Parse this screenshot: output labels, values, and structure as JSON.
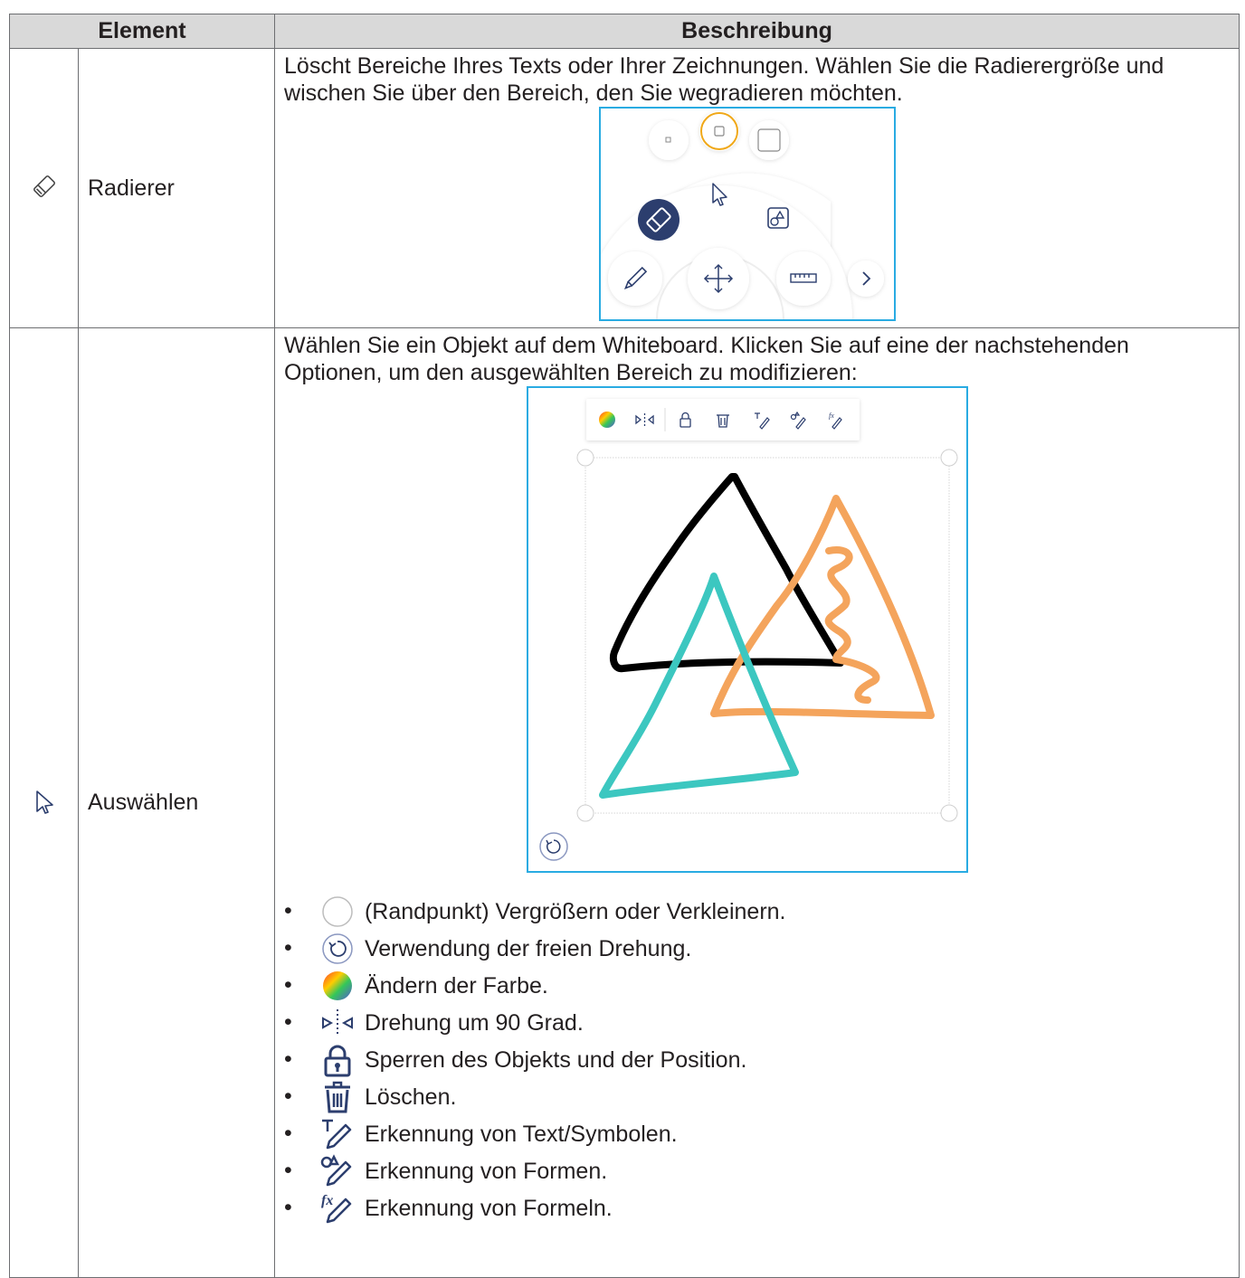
{
  "table": {
    "headers": {
      "element": "Element",
      "description": "Beschreibung"
    },
    "rows": [
      {
        "name": "Radierer",
        "icon": "eraser-icon",
        "description": "Löscht Bereiche Ihres Texts oder Ihrer Zeichnungen. Wählen Sie die Radierergröße und wischen Sie über den Bereich, den Sie wegradieren möchten."
      },
      {
        "name": "Auswählen",
        "icon": "select-arrow-icon",
        "description": "Wählen Sie ein Objekt auf dem Whiteboard. Klicken Sie auf eine der nachstehenden Optionen, um den ausgewählten Bereich zu modifizieren:",
        "bullets": [
          {
            "icon": "handle-point-icon",
            "text": "(Randpunkt) Vergrößern oder Verkleinern."
          },
          {
            "icon": "rotate-icon",
            "text": "Verwendung der freien Drehung."
          },
          {
            "icon": "color-wheel-icon",
            "text": "Ändern der Farbe."
          },
          {
            "icon": "flip-icon",
            "text": "Drehung um 90 Grad."
          },
          {
            "icon": "lock-icon",
            "text": "Sperren des Objekts und der Position."
          },
          {
            "icon": "trash-icon",
            "text": "Löschen."
          },
          {
            "icon": "text-recognition-icon",
            "text": "Erkennung von Text/Symbolen."
          },
          {
            "icon": "shape-recognition-icon",
            "text": "Erkennung von Formen."
          },
          {
            "icon": "formula-recognition-icon",
            "text": "Erkennung von Formeln."
          }
        ]
      }
    ]
  },
  "colors": {
    "header_bg": "#d9d9d9",
    "figure_border": "#29abe2",
    "icon_navy": "#2c3e6e",
    "triangle_black": "#000000",
    "triangle_orange": "#f4a45c",
    "triangle_teal": "#3cc7c0"
  }
}
